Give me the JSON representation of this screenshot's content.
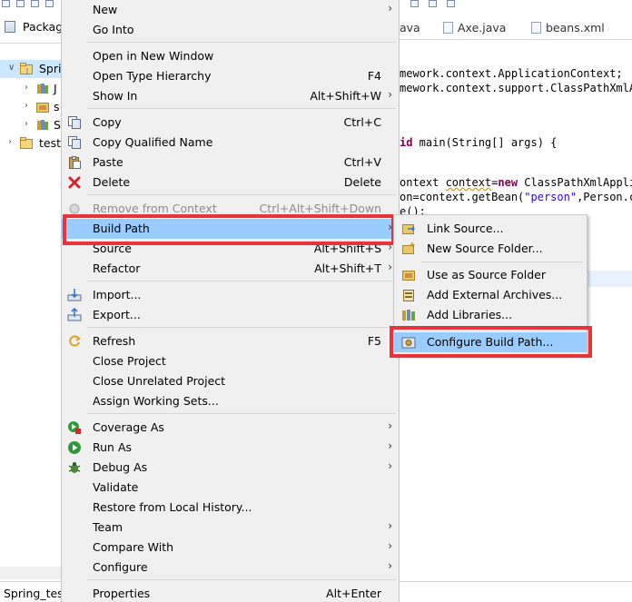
{
  "left_panel": {
    "tab_label": "Packag",
    "tree": [
      {
        "label": "Sprin"
      },
      {
        "label": "J"
      },
      {
        "label": "s"
      },
      {
        "label": "S"
      },
      {
        "label": "test"
      }
    ],
    "bottom_label": "Spring_test"
  },
  "editor": {
    "tabs": [
      {
        "label": "ava"
      },
      {
        "label": "Axe.java"
      },
      {
        "label": "beans.xml"
      }
    ],
    "code": {
      "l1": "mework.context.ApplicationContext;",
      "l2": "mework.context.support.ClassPathXmlA",
      "l3_kw": "id",
      "l3": " main(String[] args) {",
      "l4_a": "ontext ",
      "l4_b": "context",
      "l4_c": "=",
      "l4_kw": "new",
      "l4_d": " ClassPathXmlAppli",
      "l5_a": "on=context.getBean(",
      "l5_str": "\"person\"",
      "l5_b": ",Person.cl",
      "l6": "e();"
    }
  },
  "context_menu": {
    "items": {
      "new": {
        "label": "New"
      },
      "go_into": {
        "label": "Go Into"
      },
      "open_new_window": {
        "label": "Open in New Window"
      },
      "open_type_hierarchy": {
        "label": "Open Type Hierarchy",
        "accel": "F4"
      },
      "show_in": {
        "label": "Show In",
        "accel": "Alt+Shift+W"
      },
      "copy": {
        "label": "Copy",
        "accel": "Ctrl+C"
      },
      "copy_qualified": {
        "label": "Copy Qualified Name"
      },
      "paste": {
        "label": "Paste",
        "accel": "Ctrl+V"
      },
      "delete": {
        "label": "Delete",
        "accel": "Delete"
      },
      "remove_context": {
        "label": "Remove from Context",
        "accel": "Ctrl+Alt+Shift+Down"
      },
      "build_path": {
        "label": "Build Path"
      },
      "source": {
        "label": "Source",
        "accel": "Alt+Shift+S"
      },
      "refactor": {
        "label": "Refactor",
        "accel": "Alt+Shift+T"
      },
      "import": {
        "label": "Import..."
      },
      "export": {
        "label": "Export..."
      },
      "refresh": {
        "label": "Refresh",
        "accel": "F5"
      },
      "close_project": {
        "label": "Close Project"
      },
      "close_unrelated": {
        "label": "Close Unrelated Project"
      },
      "assign_working_sets": {
        "label": "Assign Working Sets..."
      },
      "coverage_as": {
        "label": "Coverage As"
      },
      "run_as": {
        "label": "Run As"
      },
      "debug_as": {
        "label": "Debug As"
      },
      "validate": {
        "label": "Validate"
      },
      "restore_history": {
        "label": "Restore from Local History..."
      },
      "team": {
        "label": "Team"
      },
      "compare_with": {
        "label": "Compare With"
      },
      "configure": {
        "label": "Configure"
      },
      "properties": {
        "label": "Properties",
        "accel": "Alt+Enter"
      }
    },
    "arrow_glyph": "›"
  },
  "submenu": {
    "link_source": "Link Source...",
    "new_source_folder": "New Source Folder...",
    "use_as_source_folder": "Use as Source Folder",
    "add_external_archives": "Add External Archives...",
    "add_libraries": "Add Libraries...",
    "configure_build_path": "Configure Build Path..."
  },
  "colors": {
    "highlight": "#99ccff",
    "annotation_box": "#e8333a",
    "menu_bg": "#f0f0f0"
  }
}
